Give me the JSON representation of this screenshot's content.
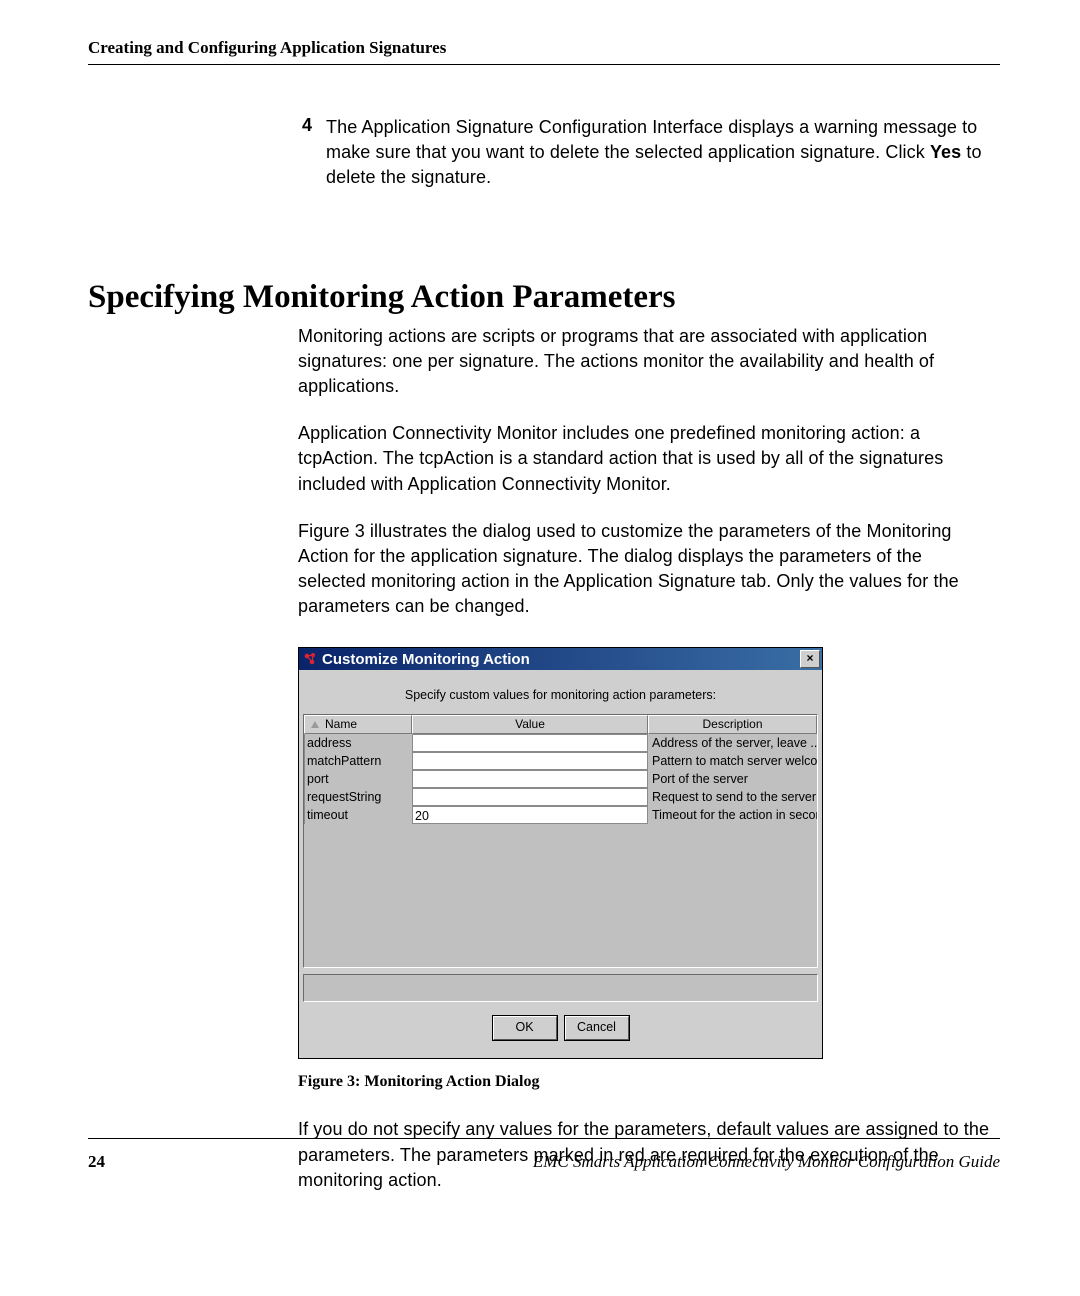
{
  "header": {
    "running": "Creating and Configuring Application Signatures"
  },
  "step4": {
    "num": "4",
    "text_a": "The Application Signature Configuration Interface displays a warning message to make sure that you want to delete the selected application signature. Click ",
    "yes": "Yes",
    "text_b": " to delete the signature."
  },
  "h1": "Specifying Monitoring Action Parameters",
  "para1": "Monitoring actions are scripts or programs that are associated with application signatures: one per signature. The actions monitor the availability and health of applications.",
  "para2": "Application Connectivity Monitor includes one predefined monitoring action: a tcpAction. The tcpAction is a standard action that is used by all of the signatures included with Application Connectivity Monitor.",
  "para3": "Figure 3 illustrates the dialog used to customize the parameters of the Monitoring Action for the application signature. The dialog displays the parameters of the selected monitoring action in the Application Signature tab. Only the values for the parameters can be changed.",
  "dialog": {
    "title": "Customize Monitoring Action",
    "instruction": "Specify custom values for monitoring action parameters:",
    "cols": {
      "name": "Name",
      "value": "Value",
      "desc": "Description"
    },
    "rows": [
      {
        "name": "address",
        "value": "",
        "desc": "Address of the server, leave ..."
      },
      {
        "name": "matchPattern",
        "value": "",
        "desc": "Pattern to match server welco..."
      },
      {
        "name": "port",
        "value": "",
        "desc": "Port of the server"
      },
      {
        "name": "requestString",
        "value": "",
        "desc": "Request to send to the server"
      },
      {
        "name": "timeout",
        "value": "20",
        "desc": "Timeout for the action in secon..."
      }
    ],
    "ok": "OK",
    "cancel": "Cancel",
    "close": "×"
  },
  "caption": "Figure 3: Monitoring Action Dialog",
  "para4": "If you do not specify any values for the parameters, default values are assigned to the parameters. The parameters marked in red are required for the execution of the monitoring action.",
  "footer": {
    "page": "24",
    "title": "EMC Smarts Application Connectivity Monitor Configuration Guide"
  }
}
